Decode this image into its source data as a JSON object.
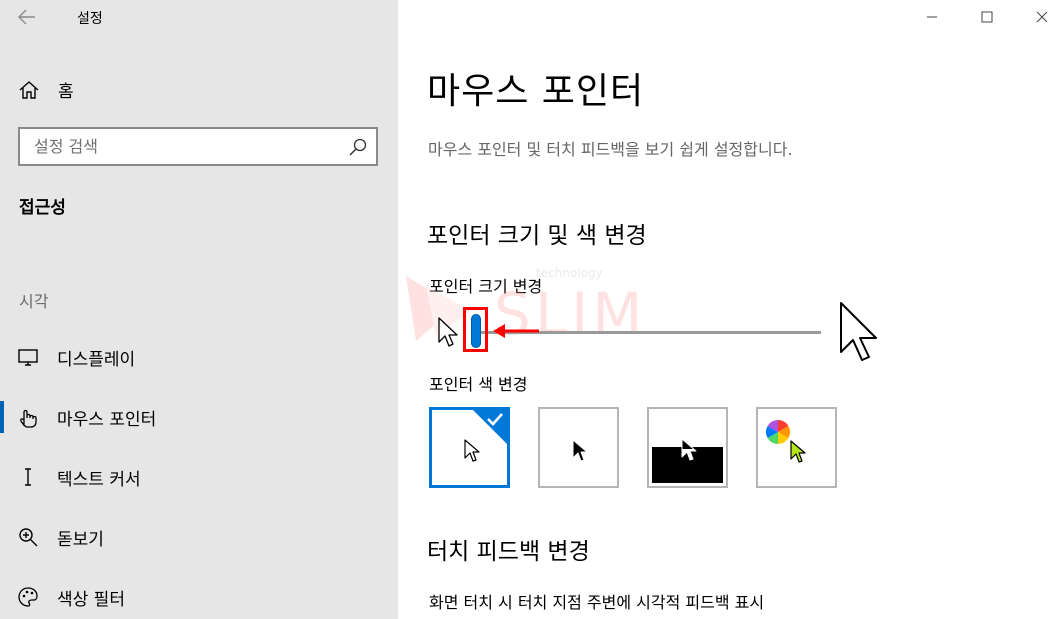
{
  "window": {
    "title": "설정"
  },
  "sidebar": {
    "home_label": "홈",
    "search_placeholder": "설정 검색",
    "category": "접근성",
    "group_label": "시각",
    "items": [
      {
        "label": "디스플레이",
        "icon": "monitor-icon",
        "active": false
      },
      {
        "label": "마우스 포인터",
        "icon": "mouse-pointer-icon",
        "active": true
      },
      {
        "label": "텍스트 커서",
        "icon": "text-cursor-icon",
        "active": false
      },
      {
        "label": "돋보기",
        "icon": "magnifier-icon",
        "active": false
      },
      {
        "label": "색상 필터",
        "icon": "palette-icon",
        "active": false
      }
    ]
  },
  "main": {
    "title": "마우스 포인터",
    "description": "마우스 포인터 및 터치 피드백을 보기 쉽게 설정합니다.",
    "pointer_section": {
      "heading": "포인터 크기 및 색 변경",
      "size_label": "포인터 크기 변경",
      "size_value": 1,
      "size_max": 15,
      "color_label": "포인터 색 변경",
      "color_options": [
        {
          "name": "white",
          "selected": true
        },
        {
          "name": "black",
          "selected": false
        },
        {
          "name": "inverted",
          "selected": false
        },
        {
          "name": "custom",
          "selected": false
        }
      ]
    },
    "touch_section": {
      "heading": "터치 피드백 변경",
      "option_label": "화면 터치 시 터치 지점 주변에 시각적 피드백 표시"
    }
  },
  "watermark": {
    "text": "SLIM",
    "small_text": "technology"
  },
  "colors": {
    "accent": "#0078d7",
    "sidebar_bg": "#e6e6e6",
    "highlight": "#ff0000"
  }
}
